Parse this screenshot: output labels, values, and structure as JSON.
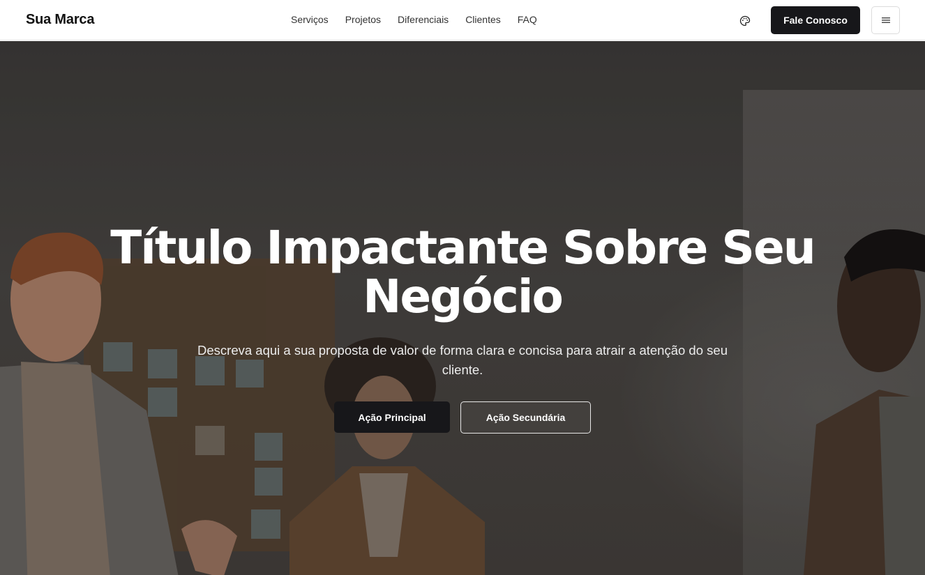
{
  "header": {
    "brand": "Sua Marca",
    "nav": [
      "Serviços",
      "Projetos",
      "Diferenciais",
      "Clientes",
      "FAQ"
    ],
    "palette_icon": "palette-icon",
    "cta_label": "Fale Conosco",
    "menu_icon": "hamburger-menu-icon"
  },
  "hero": {
    "title": "Título Impactante Sobre Seu Negócio",
    "subtitle": "Descreva aqui a sua proposta de valor de forma clara e concisa para atrair a atenção do seu cliente.",
    "primary_label": "Ação Principal",
    "secondary_label": "Ação Secundária"
  },
  "colors": {
    "dark_button": "#17171a",
    "hero_text": "#ffffff",
    "header_bg": "#ffffff"
  }
}
